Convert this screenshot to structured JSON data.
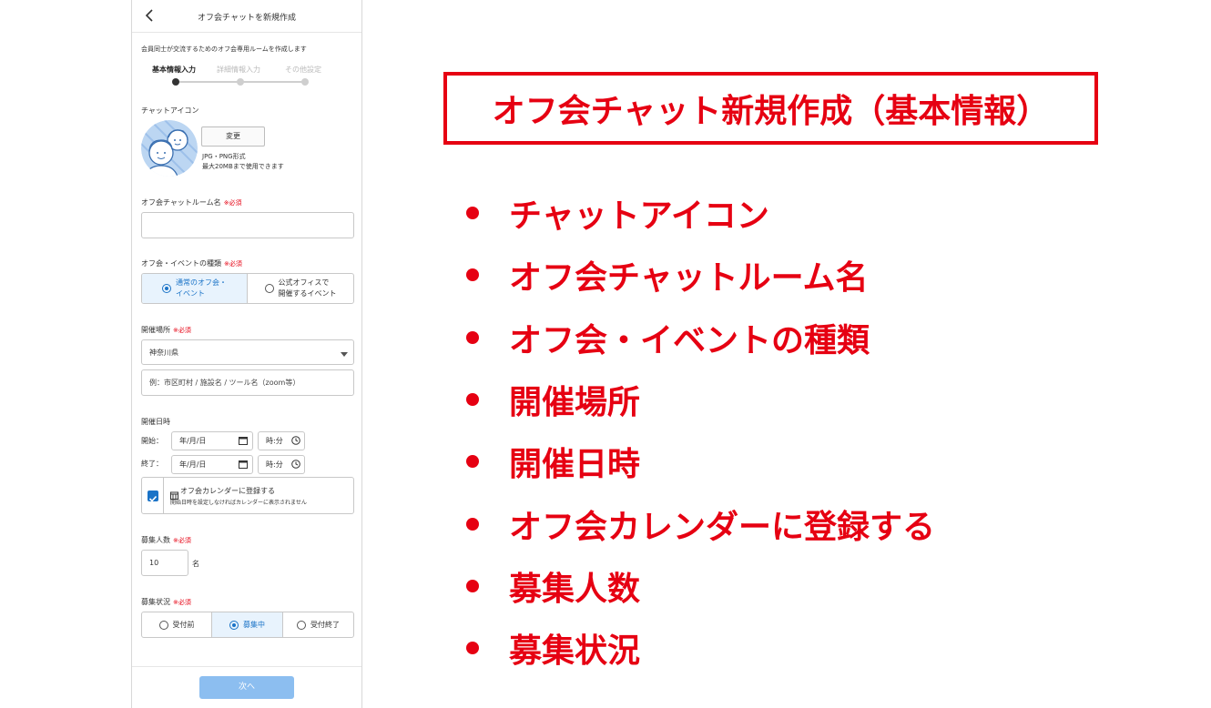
{
  "header": {
    "title": "オフ会チャットを新規作成"
  },
  "intro": "会員同士が交流するためのオフ会専用ルームを作成します",
  "steps": [
    {
      "label": "基本情報入力",
      "active": true
    },
    {
      "label": "詳細情報入力",
      "active": false
    },
    {
      "label": "その他設定",
      "active": false
    }
  ],
  "icon_section": {
    "label": "チャットアイコン",
    "change_button": "変更",
    "note_format": "JPG・PNG形式",
    "note_size": "最大20MBまで使用できます"
  },
  "required_mark": "※必須",
  "room_name": {
    "label": "オフ会チャットルーム名",
    "value": ""
  },
  "event_type": {
    "label": "オフ会・イベントの種類",
    "options": [
      {
        "line1": "通常のオフ会・",
        "line2": "イベント",
        "selected": true
      },
      {
        "line1": "公式オフィスで",
        "line2": "開催するイベント",
        "selected": false
      }
    ]
  },
  "venue": {
    "label": "開催場所",
    "prefecture": "神奈川県",
    "placeholder": "例：市区町村 / 施設名 / ツール名（zoom等）"
  },
  "datetime": {
    "label": "開催日時",
    "start_label": "開始：",
    "end_label": "終了：",
    "date_placeholder": "年/月/日",
    "time_placeholder": "時:分"
  },
  "calendar": {
    "title": "オフ会カレンダーに登録する",
    "note": "開始日時を設定しなければカレンダーに表示されません",
    "checked": true
  },
  "capacity": {
    "label": "募集人数",
    "value": "10",
    "unit": "名"
  },
  "recruit_status": {
    "label": "募集状況",
    "options": [
      {
        "label": "受付前",
        "selected": false
      },
      {
        "label": "募集中",
        "selected": true
      },
      {
        "label": "受付終了",
        "selected": false
      }
    ]
  },
  "next_button": "次へ",
  "colors": {
    "accent": "#e60012",
    "primary": "#1a73c7",
    "disabled_button": "#8cbef0"
  },
  "slide": {
    "title": "オフ会チャット新規作成（基本情報）",
    "items": [
      "チャットアイコン",
      "オフ会チャットルーム名",
      "オフ会・イベントの種類",
      "開催場所",
      "開催日時",
      "オフ会カレンダーに登録する",
      "募集人数",
      "募集状況"
    ]
  }
}
